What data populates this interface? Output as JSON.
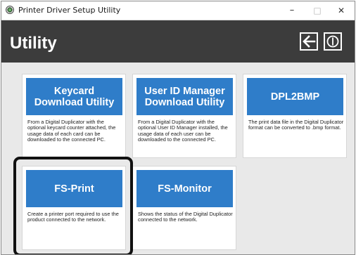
{
  "window": {
    "title": "Printer Driver Setup Utility",
    "minimize_glyph": "–",
    "maximize_glyph": "□",
    "close_glyph": "✕"
  },
  "header": {
    "title": "Utility",
    "back_icon": "arrow-left-icon",
    "power_icon": "power-icon",
    "background_color": "#3c3c3c"
  },
  "accent_color": "#2f7dc9",
  "cards": [
    {
      "title": "Keycard Download Utility",
      "description": "From a Digital Duplicator with the optional keycard counter attached, the usage data of each card can be downloaded to the connected PC."
    },
    {
      "title": "User ID Manager Download Utility",
      "description": "From a Digital Duplicator with the optional User ID Manager installed, the usage data of each user can be downloaded to the connected PC."
    },
    {
      "title": "DPL2BMP",
      "description": "The print data file in the Digital Duplicator format can be converted to .bmp format."
    },
    {
      "title": "FS-Print",
      "description": "Create a printer port required to use the product connected to the network.",
      "highlighted": true
    },
    {
      "title": "FS-Monitor",
      "description": "Shows the status of the Digital Duplicator connected to the network."
    }
  ]
}
